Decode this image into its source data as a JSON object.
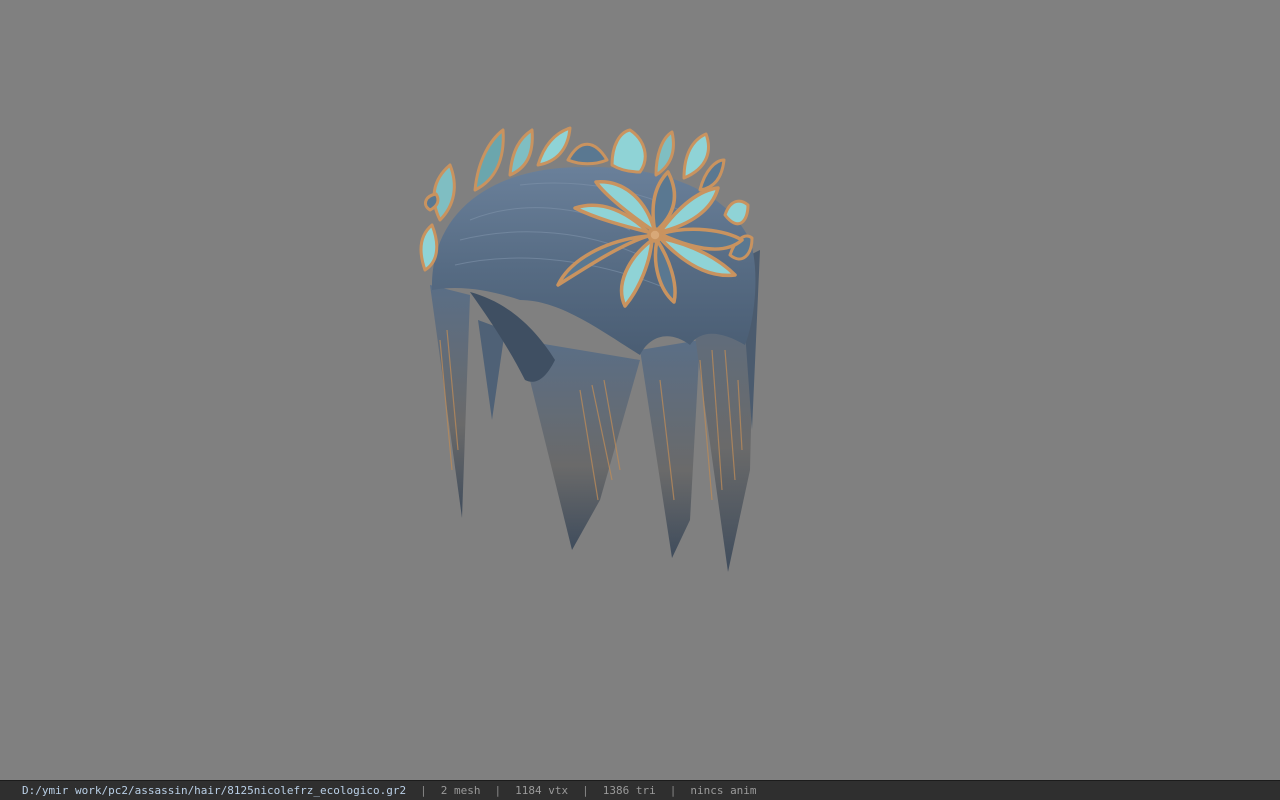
{
  "viewer": {
    "background_color": "#808080",
    "model_label": "hair-model-with-leaf-crown",
    "colors": {
      "hair": "#5d7189",
      "hair_shadow": "#465a70",
      "leaf_fill": "#8fd3d6",
      "leaf_dark": "#5a7891",
      "leaf_rim": "#c9935f"
    }
  },
  "status": {
    "file_path": "D:/ymir work/pc2/assassin/hair/8125nicolefrz_ecologico.gr2",
    "separator": "|",
    "mesh": "2 mesh",
    "vtx": "1184 vtx",
    "tri": "1386 tri",
    "anim": "nincs anim"
  }
}
